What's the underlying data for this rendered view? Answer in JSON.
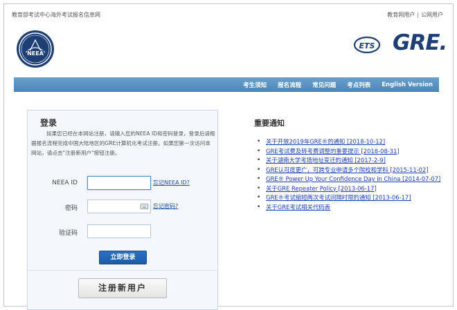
{
  "header": {
    "site_title": "教育部考试中心海外考试报名信息网",
    "links": [
      "教育网用户",
      "公网用户"
    ],
    "separator": "|",
    "ets_logo_text": "ETS",
    "brand": "GRE."
  },
  "nav": {
    "items": [
      "考生须知",
      "报名流程",
      "常见问题",
      "考点列表",
      "English Version"
    ]
  },
  "login": {
    "title": "登录",
    "intro": "如果您已经在本网站注册，请输入您的NEEA ID和密码登录，登录后请根据报名流程完成中国大陆地区的GRE计算机化考试注册。如果您第一次访问本网站，请点击\"注册新用户\"按钮注册。",
    "neea_label": "NEEA ID",
    "neea_value": "",
    "forgot_id": "忘记NEEA ID?",
    "password_label": "密码",
    "password_value": "",
    "forgot_password": "忘记密码?",
    "captcha_label": "验证码",
    "captcha_value": "",
    "login_button": "立即登录",
    "register_button": "注册新用户"
  },
  "notices": {
    "title": "重要通知",
    "items": [
      "关于开放2019年GRE®的通知 [2018-10-12]",
      "GRE考试费及转考费调整的重要提示 [2018-08-31]",
      "关于湖南大学考场地址变迁的通知 [2017-2-9]",
      "GRE认可度更广，可跨专业申请多个院校和学科 [2015-11-02]",
      "GRE® Power Up Your Confidence Day in China [2014-07-07]",
      "关于GRE Repeater Policy [2013-06-17]",
      "GRE®考试缩短两次考试间隔时限的通知 [2013-06-17]",
      "关于GRE考试相关代码表"
    ]
  },
  "colors": {
    "nav_bar": "#5b93c3",
    "brand_blue": "#1d3f76",
    "link": "#1e3fb8",
    "login_button": "#2468b8"
  }
}
